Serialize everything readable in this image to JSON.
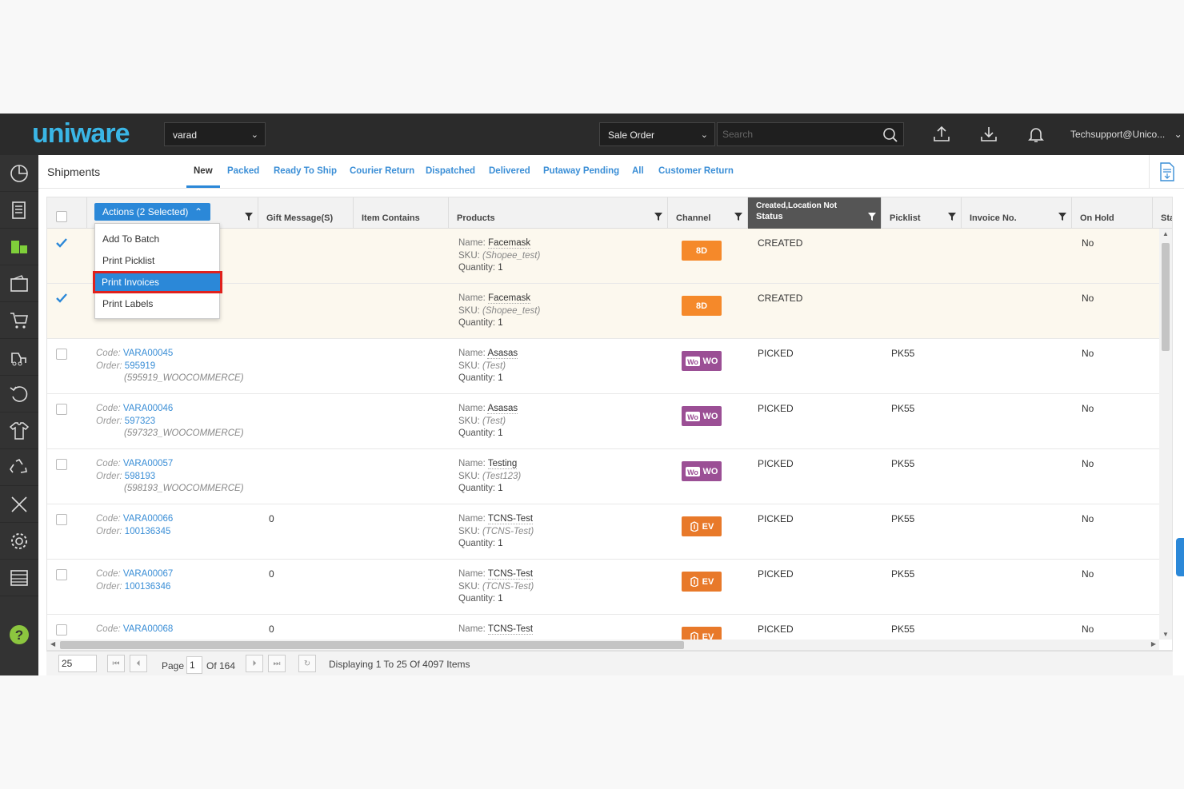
{
  "topbar": {
    "logo_text": "uniware",
    "facility": "varad",
    "search_scope": "Sale Order",
    "search_placeholder": "Search",
    "user": "Techsupport@Unico..."
  },
  "tabsbar": {
    "title": "Shipments",
    "tabs": [
      "New",
      "Packed",
      "Ready To Ship",
      "Courier Return",
      "Dispatched",
      "Delivered",
      "Putaway Pending",
      "All",
      "Customer Return"
    ],
    "active_tab": "New"
  },
  "grid": {
    "headers": {
      "gift": "Gift Message(S)",
      "item_contains": "Item Contains",
      "products": "Products",
      "channel": "Channel",
      "status_top": "Created,Location Not",
      "status": "Status",
      "picklist": "Picklist",
      "invoice": "Invoice No.",
      "on_hold": "On Hold",
      "sta": "Sta"
    },
    "rows": [
      {
        "selected": true,
        "code": "",
        "order": "",
        "order_ref": "",
        "gift": "",
        "product": "Facemask",
        "sku": "Shopee_test",
        "qty": "1",
        "channel": "8D",
        "status": "CREATED",
        "picklist": "",
        "on_hold": "No"
      },
      {
        "selected": true,
        "code": "",
        "order": "",
        "order_ref": "",
        "gift": "",
        "product": "Facemask",
        "sku": "Shopee_test",
        "qty": "1",
        "channel": "8D",
        "status": "CREATED",
        "picklist": "",
        "on_hold": "No"
      },
      {
        "selected": false,
        "code": "VARA00045",
        "order": "595919",
        "order_ref": "(595919_WOOCOMMERCE)",
        "gift": "",
        "product": "Asasas",
        "sku": "Test",
        "qty": "1",
        "channel": "WO",
        "status": "PICKED",
        "picklist": "PK55",
        "on_hold": "No"
      },
      {
        "selected": false,
        "code": "VARA00046",
        "order": "597323",
        "order_ref": "(597323_WOOCOMMERCE)",
        "gift": "",
        "product": "Asasas",
        "sku": "Test",
        "qty": "1",
        "channel": "WO",
        "status": "PICKED",
        "picklist": "PK55",
        "on_hold": "No"
      },
      {
        "selected": false,
        "code": "VARA00057",
        "order": "598193",
        "order_ref": "(598193_WOOCOMMERCE)",
        "gift": "",
        "product": "Testing",
        "sku": "Test123",
        "qty": "1",
        "channel": "WO",
        "status": "PICKED",
        "picklist": "PK55",
        "on_hold": "No"
      },
      {
        "selected": false,
        "code": "VARA00066",
        "order": "100136345",
        "order_ref": "",
        "gift": "0",
        "product": "TCNS-Test",
        "sku": "TCNS-Test",
        "qty": "1",
        "channel": "EV",
        "status": "PICKED",
        "picklist": "PK55",
        "on_hold": "No"
      },
      {
        "selected": false,
        "code": "VARA00067",
        "order": "100136346",
        "order_ref": "",
        "gift": "0",
        "product": "TCNS-Test",
        "sku": "TCNS-Test",
        "qty": "1",
        "channel": "EV",
        "status": "PICKED",
        "picklist": "PK55",
        "on_hold": "No"
      },
      {
        "selected": false,
        "code": "VARA00068",
        "order": "",
        "order_ref": "",
        "gift": "0",
        "product": "TCNS-Test",
        "sku": "",
        "qty": "",
        "channel": "EV",
        "status": "PICKED",
        "picklist": "PK55",
        "on_hold": "No"
      }
    ],
    "labels": {
      "code": "Code:",
      "order": "Order:",
      "name": "Name:",
      "sku": "SKU:",
      "qty": "Quantity:"
    }
  },
  "actions": {
    "button_label": "Actions (2 Selected)",
    "items": [
      "Add To Batch",
      "Print Picklist",
      "Print Invoices",
      "Print Labels"
    ],
    "highlighted": "Print Invoices"
  },
  "pager": {
    "page_size": "25",
    "page_label": "Page",
    "page": "1",
    "of_label": "Of 164",
    "display": "Displaying 1 To 25 Of 4097 Items"
  },
  "colors": {
    "accent": "#2b88d8",
    "orange_badge": "#f5892a",
    "woo_badge": "#9b4f95",
    "highlight_border": "#e0211d"
  }
}
